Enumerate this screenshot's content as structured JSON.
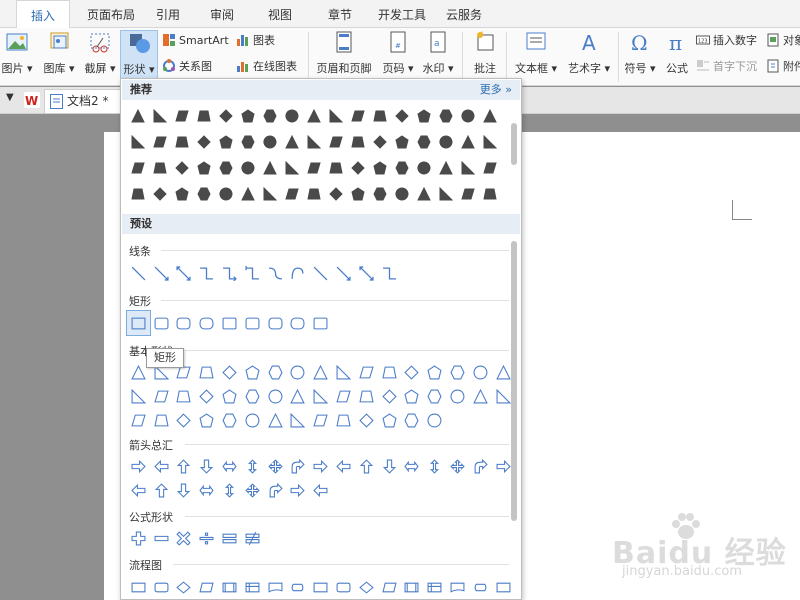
{
  "tabs": [
    "插入",
    "页面布局",
    "引用",
    "审阅",
    "视图",
    "章节",
    "开发工具",
    "云服务"
  ],
  "ribbon": {
    "picture": "图片",
    "library": "图库",
    "screenshot": "截屏",
    "shape": "形状",
    "smartart": "SmartArt",
    "relation": "关系图",
    "chart": "图表",
    "online_chart": "在线图表",
    "header_footer": "页眉和页脚",
    "page_number": "页码",
    "watermark": "水印",
    "comment": "批注",
    "textbox": "文本框",
    "wordart": "艺术字",
    "symbol": "符号",
    "formula": "公式",
    "insert_number": "插入数字",
    "drop_cap": "首字下沉",
    "object": "对象",
    "attachment": "附件"
  },
  "doc_tab": "文档2 *",
  "dropdown": {
    "recommended": "推荐",
    "more": "更多",
    "preset": "预设",
    "sections": {
      "lines": "线条",
      "rect": "矩形",
      "basic": "基本形状",
      "arrows": "箭头总汇",
      "formula": "公式形状",
      "flowchart": "流程图"
    },
    "tooltip": "矩形"
  },
  "watermark_text": {
    "brand": "Baidu 经验",
    "url": "jingyan.baidu.com"
  },
  "colors": {
    "accent": "#2b6cb0",
    "shape_blue": "#4a7cc8",
    "shape_dark": "#4a4a4a"
  }
}
